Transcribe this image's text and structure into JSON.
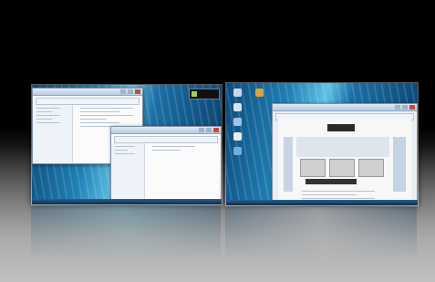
{
  "scene": {
    "background_top": "#000000",
    "background_bottom": "#b9b9b9",
    "wallpaper_accent": "#1f7fb4"
  },
  "desktops": [
    {
      "id": "desktop-left",
      "windows": [
        {
          "id": "explorer-back",
          "icon": "folder-icon"
        },
        {
          "id": "explorer-front",
          "icon": "folder-icon"
        }
      ],
      "gadgets": [
        {
          "icon": "clock-gadget-icon"
        }
      ]
    },
    {
      "id": "desktop-right",
      "desktop_icons": [
        "computer-icon",
        "folder-icon",
        "recycle-bin-icon",
        "network-icon",
        "document-icon",
        "globe-icon"
      ],
      "windows": [
        {
          "id": "browser",
          "icon": "browser-icon"
        }
      ]
    }
  ]
}
